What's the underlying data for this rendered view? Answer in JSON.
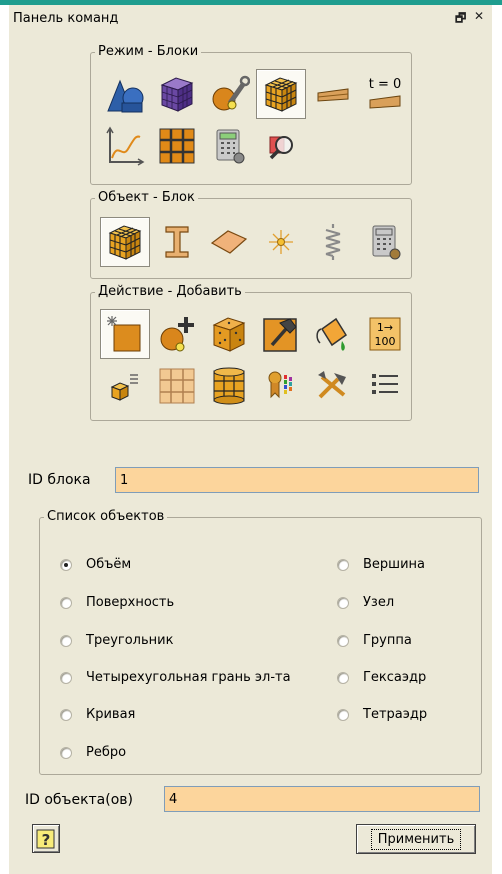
{
  "panel": {
    "title": "Панель команд",
    "restore_glyph": "🗗",
    "close_glyph": "✕"
  },
  "groups": {
    "mode": {
      "legend": "Режим - Блоки",
      "buttons": [
        {
          "icon": "geometry-shapes-icon",
          "selected": false
        },
        {
          "icon": "mesh-cube-icon",
          "selected": false
        },
        {
          "icon": "geometry-tools-icon",
          "selected": false
        },
        {
          "icon": "blocks-cube-icon",
          "selected": true
        },
        {
          "icon": "boundary-strip-icon",
          "selected": false
        },
        {
          "icon": "initial-condition-icon",
          "label": "t = 0",
          "selected": false
        },
        {
          "icon": "graph-curve-icon",
          "selected": false
        },
        {
          "icon": "grid-window-icon",
          "selected": false
        },
        {
          "icon": "calculator-icon",
          "selected": false
        },
        {
          "icon": "inspect-magnifier-icon",
          "selected": false
        }
      ]
    },
    "object": {
      "legend": "Объект - Блок",
      "buttons": [
        {
          "icon": "block-cube-icon",
          "selected": true
        },
        {
          "icon": "beam-i-icon",
          "selected": false
        },
        {
          "icon": "shell-plate-icon",
          "selected": false
        },
        {
          "icon": "node-star-icon",
          "selected": false
        },
        {
          "icon": "spring-coil-icon",
          "selected": false
        },
        {
          "icon": "calculator-gear-icon",
          "selected": false
        }
      ]
    },
    "action": {
      "legend": "Действие - Добавить",
      "buttons": [
        {
          "icon": "add-new-icon",
          "selected": true
        },
        {
          "icon": "add-element-icon",
          "selected": false
        },
        {
          "icon": "mesh-box-icon",
          "selected": false
        },
        {
          "icon": "hammer-icon",
          "selected": false
        },
        {
          "icon": "paint-bucket-icon",
          "selected": false
        },
        {
          "icon": "renumber-icon",
          "label_top": "1→",
          "label_bottom": "100",
          "selected": false
        },
        {
          "icon": "list-cube-icon",
          "selected": false
        },
        {
          "icon": "split-grid-icon",
          "selected": false
        },
        {
          "icon": "cylinder-grid-icon",
          "selected": false
        },
        {
          "icon": "material-ribbon-icon",
          "selected": false
        },
        {
          "icon": "delete-tools-icon",
          "selected": false
        },
        {
          "icon": "list-icon",
          "selected": false
        }
      ]
    }
  },
  "block_id": {
    "label": "ID блока",
    "value": "1"
  },
  "object_list": {
    "legend": "Список объектов",
    "left": [
      {
        "label": "Объём",
        "checked": true
      },
      {
        "label": "Поверхность",
        "checked": false
      },
      {
        "label": "Треугольник",
        "checked": false
      },
      {
        "label": "Четырехугольная грань эл-та",
        "checked": false
      },
      {
        "label": "Кривая",
        "checked": false
      },
      {
        "label": "Ребро",
        "checked": false
      }
    ],
    "right": [
      {
        "label": "Вершина",
        "checked": false
      },
      {
        "label": "Узел",
        "checked": false
      },
      {
        "label": "Группа",
        "checked": false
      },
      {
        "label": "Гексаэдр",
        "checked": false
      },
      {
        "label": "Тетраэдр",
        "checked": false
      }
    ]
  },
  "object_ids": {
    "label": "ID объекта(ов)",
    "value": "4"
  },
  "help": {
    "glyph": "?"
  },
  "apply": {
    "label": "Применить"
  },
  "colors": {
    "accent": "#1f9d8f",
    "input_bg": "#fcd59c",
    "panel_bg": "#ece9d8"
  }
}
